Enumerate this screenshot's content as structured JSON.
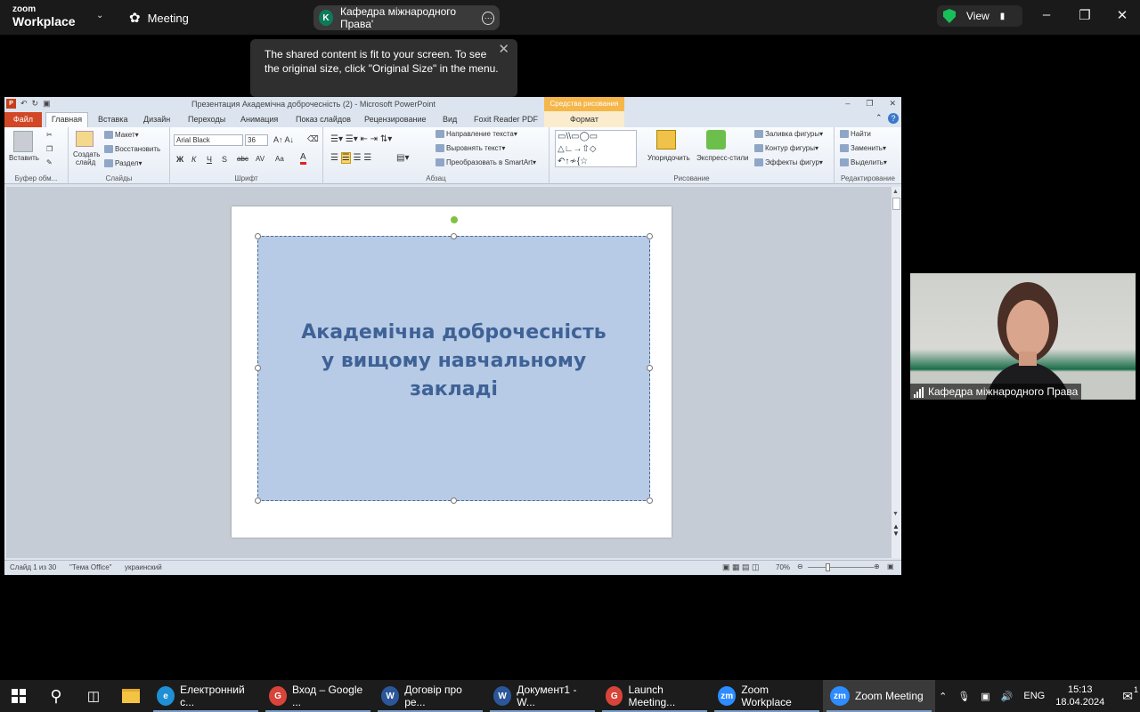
{
  "zoom": {
    "logo_top": "zoom",
    "logo_bottom": "Workplace",
    "meeting_label": "Meeting",
    "share_title": "Кафедра міжнародного Права'",
    "share_avatar": "K",
    "view_label": "View",
    "tooltip": "The shared content is fit to your screen. To see the original size, click \"Original Size\" in the menu.",
    "participant_name": "Кафедра міжнародного Права"
  },
  "ppt": {
    "window_title": "Презентация Академічна доброчесність (2)  -  Microsoft PowerPoint",
    "drawing_tools": "Средства рисования",
    "tabs": [
      "Файл",
      "Главная",
      "Вставка",
      "Дизайн",
      "Переходы",
      "Анимация",
      "Показ слайдов",
      "Рецензирование",
      "Вид",
      "Foxit Reader PDF",
      "Формат"
    ],
    "ribbon": {
      "paste": "Вставить",
      "clipboard": "Буфер обм...",
      "create_slide": "Создать",
      "slide_word": "слайд",
      "layout": "Макет",
      "reset": "Восстановить",
      "section": "Раздел",
      "slides_group": "Слайды",
      "font_name": "Arial Black",
      "font_size": "36",
      "font_group": "Шрифт",
      "bold": "Ж",
      "italic": "К",
      "underline": "Ч",
      "strike": "abc",
      "spacing": "AV",
      "case": "Aa",
      "color_a": "A",
      "text_dir": "Направление текста",
      "align_text": "Выровнять текст",
      "smartart": "Преобразовать в SmartArt",
      "paragraph_group": "Абзац",
      "arrange": "Упорядочить",
      "quick_styles": "Экспресс-стили",
      "fill": "Заливка фигуры",
      "outline": "Контур фигуры",
      "effects": "Эффекты фигур",
      "drawing_group": "Рисование",
      "find": "Найти",
      "replace": "Заменить",
      "select": "Выделить",
      "editing_group": "Редактирование"
    },
    "slide_text": [
      "Академічна доброчесність",
      "у вищому навчальному",
      "закладі"
    ],
    "status": {
      "slide": "Слайд 1 из 30",
      "theme": "\"Тема Office\"",
      "lang": "украинский",
      "zoom": "70%"
    }
  },
  "taskbar": {
    "apps": [
      {
        "label": "Електронний с...",
        "icon": "edge-icon",
        "color": "#1f8fd6",
        "glyph": "e"
      },
      {
        "label": "Вход – Google ...",
        "icon": "chrome-icon",
        "color": "#d8443a",
        "glyph": "G"
      },
      {
        "label": "Договір про ре...",
        "icon": "word-icon",
        "color": "#2b579a",
        "glyph": "W"
      },
      {
        "label": "Документ1 - W...",
        "icon": "word-icon",
        "color": "#2b579a",
        "glyph": "W"
      },
      {
        "label": "Launch Meeting...",
        "icon": "chrome-icon",
        "color": "#d8443a",
        "glyph": "G"
      },
      {
        "label": "Zoom Workplace",
        "icon": "zoom-icon",
        "color": "#2d8cff",
        "glyph": "zm"
      },
      {
        "label": "Zoom Meeting",
        "icon": "zoom-icon",
        "color": "#2d8cff",
        "glyph": "zm"
      }
    ],
    "lang": "ENG",
    "time": "15:13",
    "date": "18.04.2024",
    "notif_count": "1"
  }
}
